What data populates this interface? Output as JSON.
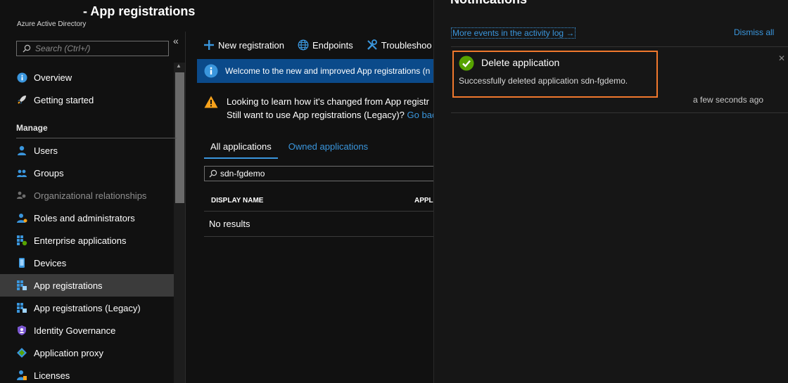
{
  "header": {
    "title": "- App registrations",
    "subtitle": "Azure Active Directory"
  },
  "sidebar": {
    "search_placeholder": "Search (Ctrl+/)",
    "collapse_glyph": "«",
    "manage_label": "Manage",
    "items": [
      {
        "label": "Overview",
        "icon": "info-icon"
      },
      {
        "label": "Getting started",
        "icon": "rocket-icon"
      },
      {
        "label": "Users",
        "icon": "user-icon"
      },
      {
        "label": "Groups",
        "icon": "group-icon"
      },
      {
        "label": "Organizational relationships",
        "icon": "org-relationships-icon"
      },
      {
        "label": "Roles and administrators",
        "icon": "roles-icon"
      },
      {
        "label": "Enterprise applications",
        "icon": "enterprise-apps-icon"
      },
      {
        "label": "Devices",
        "icon": "device-icon"
      },
      {
        "label": "App registrations",
        "icon": "app-registrations-icon"
      },
      {
        "label": "App registrations (Legacy)",
        "icon": "app-registrations-legacy-icon"
      },
      {
        "label": "Identity Governance",
        "icon": "identity-governance-icon"
      },
      {
        "label": "Application proxy",
        "icon": "application-proxy-icon"
      },
      {
        "label": "Licenses",
        "icon": "licenses-icon"
      }
    ],
    "selected_item": "App registrations"
  },
  "toolbar": {
    "new_registration": "New registration",
    "endpoints": "Endpoints",
    "troubleshoot": "Troubleshoo"
  },
  "banner": {
    "text": "Welcome to the new and improved App registrations (n"
  },
  "warning": {
    "line1": "Looking to learn how it's changed from App registr",
    "line2_prefix": "Still want to use App registrations (Legacy)? ",
    "line2_link": "Go bac"
  },
  "tabs": {
    "all": "All applications",
    "owned": "Owned applications"
  },
  "filter": {
    "value": "sdn-fgdemo"
  },
  "table": {
    "columns": [
      "DISPLAY NAME",
      "APPLI"
    ],
    "empty_text": "No results"
  },
  "notifications": {
    "title": "Notifications",
    "activity_link": "More events in the activity log →",
    "dismiss_all": "Dismiss all",
    "item": {
      "title": "Delete application",
      "message": "Successfully deleted application sdn-fgdemo.",
      "time": "a few seconds ago",
      "status": "success"
    }
  },
  "colors": {
    "accent": "#3a96dd",
    "highlight_border": "#f0782d",
    "success": "#57a300",
    "banner_bg": "#0b4a8a",
    "warning": "#f7a21b"
  }
}
